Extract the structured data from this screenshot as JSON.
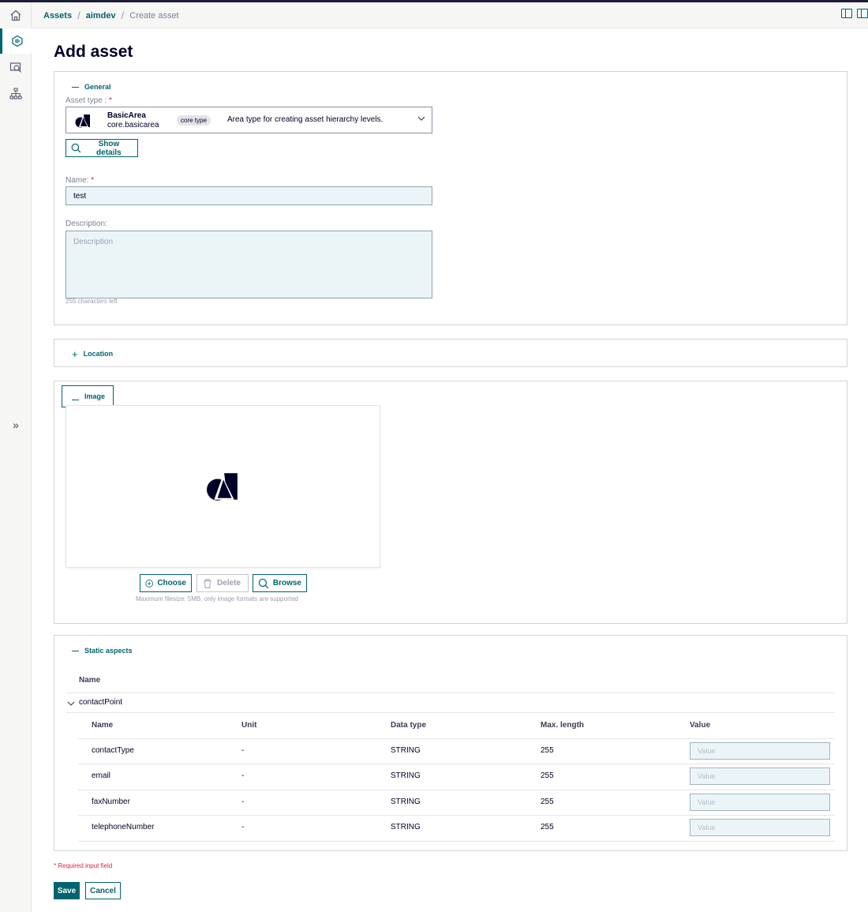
{
  "breadcrumb": {
    "items": [
      "Assets",
      "aimdev"
    ],
    "current": "Create asset"
  },
  "page": {
    "title": "Add asset"
  },
  "general": {
    "section_label": "General",
    "asset_type_label": "Asset type :",
    "required_mark": "*",
    "asset_type": {
      "name": "BasicArea",
      "id": "core.basicarea",
      "chip": "core type",
      "description": "Area type for creating asset hierarchy levels."
    },
    "show_details_label": "Show details",
    "name_label": "Name:",
    "name_value": "test",
    "description_label": "Description:",
    "description_placeholder": "Description",
    "chars_left": "255 characters left"
  },
  "location": {
    "section_label": "Location"
  },
  "image": {
    "section_label": "Image",
    "choose_label": "Choose",
    "delete_label": "Delete",
    "browse_label": "Browse",
    "hint": "Maximum filesize: 5MB, only image formats are supported"
  },
  "static_aspects": {
    "section_label": "Static aspects",
    "outer_header": "Name",
    "group_name": "contactPoint",
    "columns": [
      "Name",
      "Unit",
      "Data type",
      "Max. length",
      "Value"
    ],
    "rows": [
      {
        "name": "contactType",
        "unit": "-",
        "type": "STRING",
        "max": "255",
        "placeholder": "Value"
      },
      {
        "name": "email",
        "unit": "-",
        "type": "STRING",
        "max": "255",
        "placeholder": "Value"
      },
      {
        "name": "faxNumber",
        "unit": "-",
        "type": "STRING",
        "max": "255",
        "placeholder": "Value"
      },
      {
        "name": "telephoneNumber",
        "unit": "-",
        "type": "STRING",
        "max": "255",
        "placeholder": "Value"
      }
    ]
  },
  "footer": {
    "required_note": "* Required input field",
    "save_label": "Save",
    "cancel_label": "Cancel"
  },
  "colors": {
    "accent": "#00646e",
    "required": "#d72339",
    "input_bg": "#ebf5f7",
    "dark": "#000028"
  },
  "icons": {
    "rail": [
      "home-icon",
      "asset-manager-icon",
      "search-view-icon",
      "hierarchy-icon"
    ]
  }
}
